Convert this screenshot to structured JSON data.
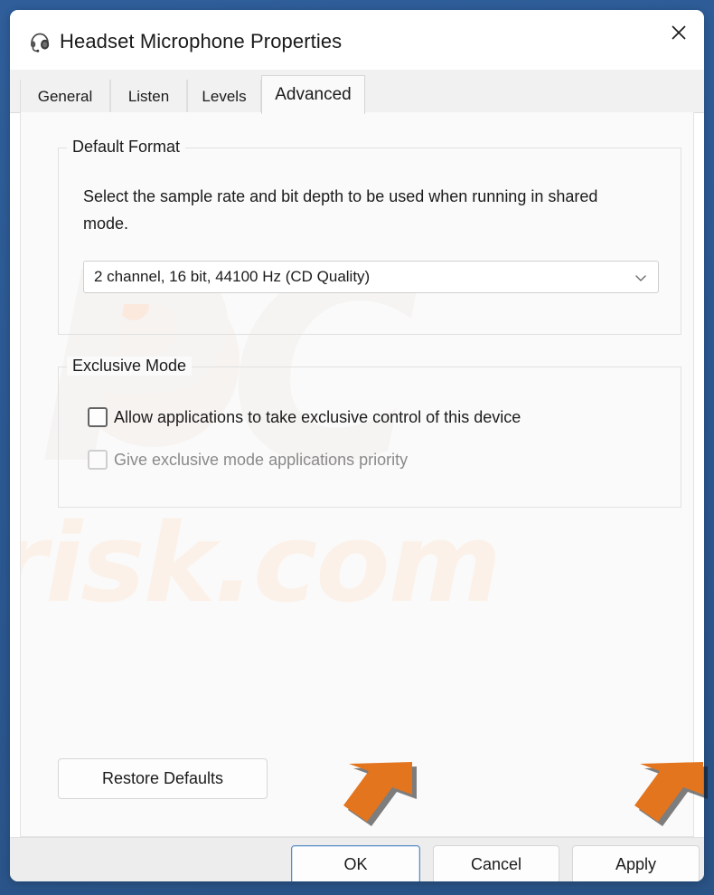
{
  "window": {
    "title": "Headset Microphone Properties",
    "icon": "headset-icon",
    "close_label": "✕",
    "frame_color": "#2e5d99"
  },
  "tabs": [
    {
      "label": "General",
      "active": false
    },
    {
      "label": "Listen",
      "active": false
    },
    {
      "label": "Levels",
      "active": false
    },
    {
      "label": "Advanced",
      "active": true
    }
  ],
  "default_format": {
    "legend": "Default Format",
    "description": "Select the sample rate and bit depth to be used when running in shared mode.",
    "combo": {
      "value": "2 channel, 16 bit, 44100 Hz (CD Quality)",
      "chevron_icon": "chevron-down-icon"
    }
  },
  "exclusive_mode": {
    "legend": "Exclusive Mode",
    "checkboxes": [
      {
        "label": "Allow applications to take exclusive control of this device",
        "checked": false,
        "disabled": false
      },
      {
        "label": "Give exclusive mode applications priority",
        "checked": false,
        "disabled": true
      }
    ]
  },
  "buttons": {
    "restore_defaults": "Restore Defaults",
    "ok": "OK",
    "cancel": "Cancel",
    "apply": "Apply"
  },
  "annotations": {
    "arrow_color": "#e3751f",
    "arrows": [
      {
        "name": "arrow-pointing-to-ok-button",
        "direction": "down-left"
      },
      {
        "name": "arrow-pointing-to-apply-button",
        "direction": "down-left"
      }
    ]
  },
  "watermark": {
    "top_text": "PC",
    "bottom_text": "risk.com"
  }
}
